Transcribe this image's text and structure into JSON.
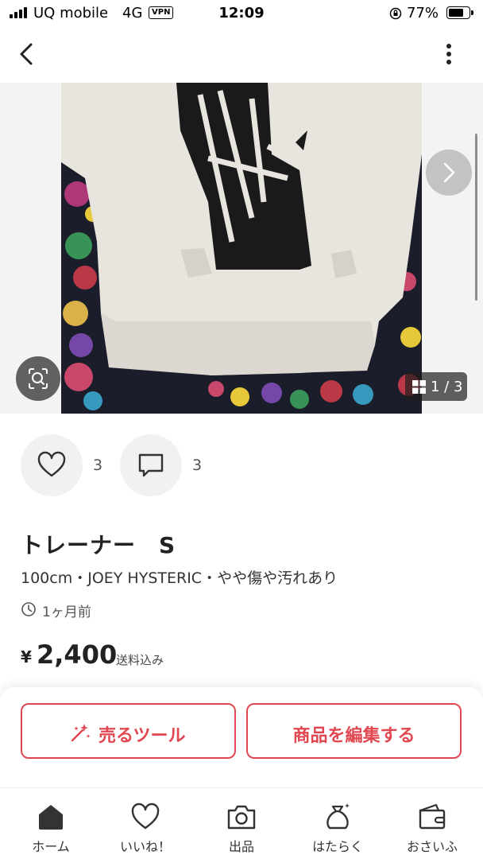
{
  "status_bar": {
    "carrier": "UQ mobile",
    "network": "4G",
    "vpn": "VPN",
    "time": "12:09",
    "battery_percent_label": "77%",
    "battery_level": 0.77
  },
  "gallery": {
    "counter": "1 / 3"
  },
  "actions": {
    "like_count": "3",
    "comment_count": "3"
  },
  "item": {
    "title": "トレーナー　S",
    "meta": "100cm・JOEY HYSTERIC・やや傷や汚れあり",
    "posted": "1ヶ月前",
    "currency_symbol": "¥",
    "price": "2,400",
    "shipping": "送料込み"
  },
  "buttons": {
    "sell_tool": "売るツール",
    "edit_item": "商品を編集する"
  },
  "tab_bar": {
    "home": "ホーム",
    "likes": "いいね！",
    "listing": "出品",
    "work": "はたらく",
    "wallet": "おさいふ"
  },
  "colors": {
    "accent": "#e14750",
    "text": "#222222"
  }
}
